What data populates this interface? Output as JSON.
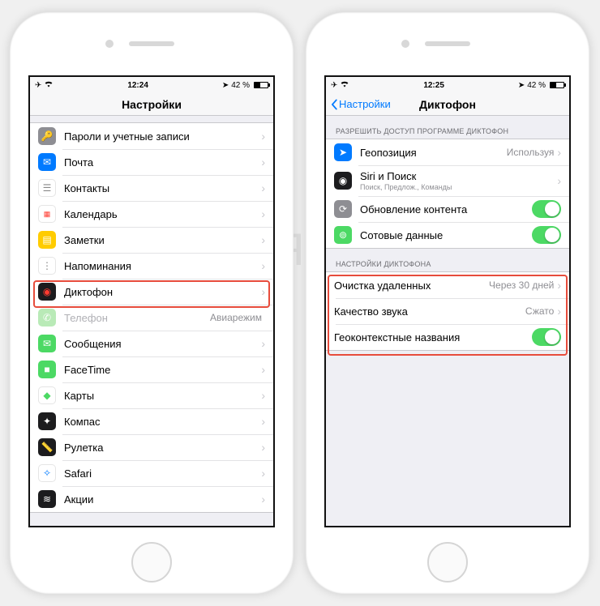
{
  "left": {
    "status": {
      "time": "12:24",
      "battery": "42 %"
    },
    "nav_title": "Настройки",
    "rows": [
      {
        "label": "Пароли и учетные записи"
      },
      {
        "label": "Почта"
      },
      {
        "label": "Контакты"
      },
      {
        "label": "Календарь"
      },
      {
        "label": "Заметки"
      },
      {
        "label": "Напоминания"
      },
      {
        "label": "Диктофон"
      },
      {
        "label": "Телефон",
        "detail": "Авиарежим"
      },
      {
        "label": "Сообщения"
      },
      {
        "label": "FaceTime"
      },
      {
        "label": "Карты"
      },
      {
        "label": "Компас"
      },
      {
        "label": "Рулетка"
      },
      {
        "label": "Safari"
      },
      {
        "label": "Акции"
      }
    ]
  },
  "right": {
    "status": {
      "time": "12:25",
      "battery": "42 %"
    },
    "back_label": "Настройки",
    "nav_title": "Диктофон",
    "section1_header": "Разрешить доступ программе Диктофон",
    "section1": [
      {
        "label": "Геопозиция",
        "detail": "Используя"
      },
      {
        "label": "Siri и Поиск",
        "sub": "Поиск, Предлож., Команды"
      },
      {
        "label": "Обновление контента"
      },
      {
        "label": "Сотовые данные"
      }
    ],
    "section2_header": "Настройки Диктофона",
    "section2": [
      {
        "label": "Очистка удаленных",
        "detail": "Через 30 дней"
      },
      {
        "label": "Качество звука",
        "detail": "Сжато"
      },
      {
        "label": "Геоконтекстные названия"
      }
    ]
  },
  "watermark": "ЯБЛЫК"
}
